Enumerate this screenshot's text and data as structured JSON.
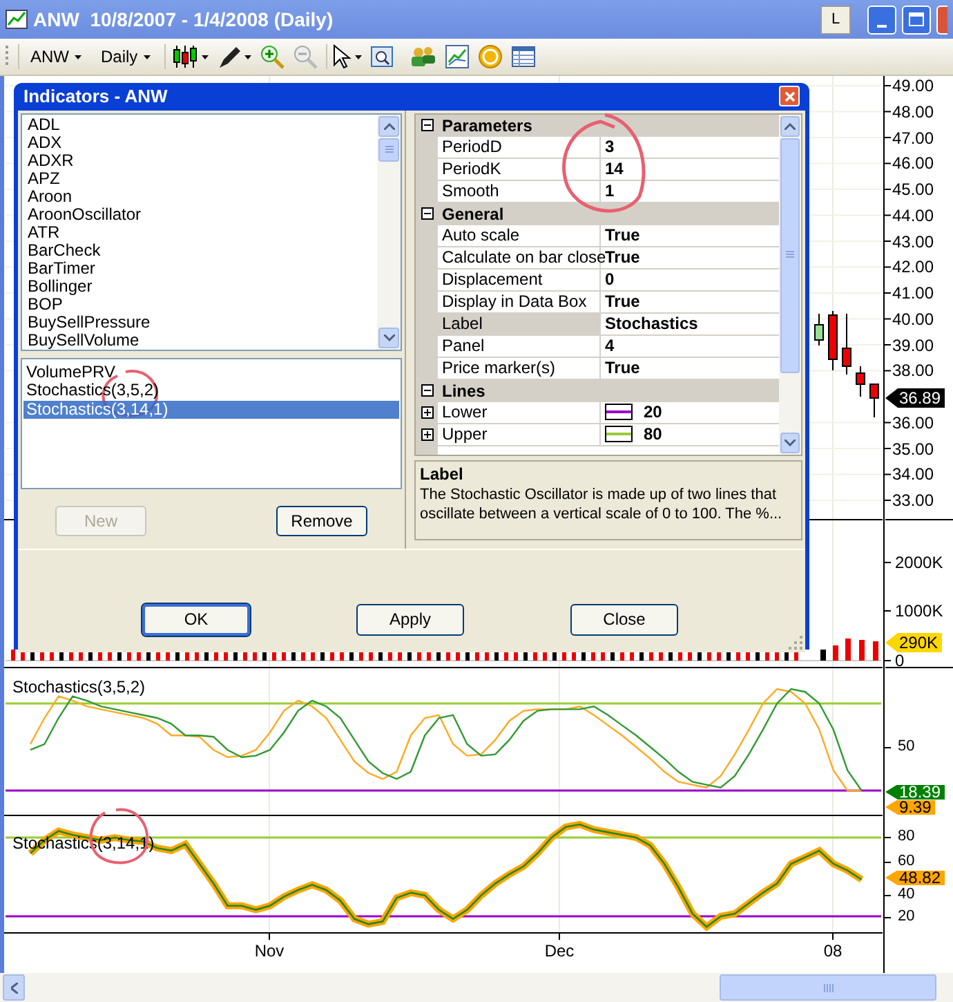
{
  "window": {
    "title": "ANW  10/8/2007 - 1/4/2008 (Daily)",
    "badge": "L"
  },
  "toolbar": {
    "symbol": "ANW",
    "interval": "Daily"
  },
  "price_axis": [
    "49.00",
    "48.00",
    "47.00",
    "46.00",
    "45.00",
    "44.00",
    "43.00",
    "42.00",
    "41.00",
    "40.00",
    "39.00",
    "38.00",
    "36.00",
    "35.00",
    "34.00",
    "33.00"
  ],
  "last_price": {
    "text": "36.89",
    "color": "#000000"
  },
  "volume_axis": [
    "2000K",
    "1000K",
    "0"
  ],
  "last_volume": {
    "text": "290K",
    "color": "#ffd700"
  },
  "panels": [
    {
      "title": "Stochastics(3,5,2)",
      "ticks": [
        "50"
      ],
      "markers": [
        {
          "text": "18.39",
          "color": "#008000"
        },
        {
          "text": "9.39",
          "color": "#ffa500"
        }
      ]
    },
    {
      "title": "Stochastics(3,14,1)",
      "ticks": [
        "80",
        "60",
        "40",
        "20"
      ],
      "markers": [
        {
          "text": "48.82",
          "color": "#ffa500"
        }
      ]
    }
  ],
  "time_axis": [
    "Nov",
    "Dec",
    "08"
  ],
  "dialog": {
    "title": "Indicators - ANW",
    "available": [
      {
        "label": "ADL",
        "selected": false
      },
      {
        "label": "ADX",
        "selected": false
      },
      {
        "label": "ADXR",
        "selected": false
      },
      {
        "label": "APZ",
        "selected": false
      },
      {
        "label": "Aroon",
        "selected": false
      },
      {
        "label": "AroonOscillator",
        "selected": false
      },
      {
        "label": "ATR",
        "selected": false
      },
      {
        "label": "BarCheck",
        "selected": false
      },
      {
        "label": "BarTimer",
        "selected": false
      },
      {
        "label": "Bollinger",
        "selected": false
      },
      {
        "label": "BOP",
        "selected": false
      },
      {
        "label": "BuySellPressure",
        "selected": false
      },
      {
        "label": "BuySellVolume",
        "selected": false
      }
    ],
    "applied": [
      {
        "label": "VolumePRV",
        "selected": false
      },
      {
        "label": "Stochastics(3,5,2)",
        "selected": false
      },
      {
        "label": "Stochastics(3,14,1)",
        "selected": true
      }
    ],
    "list_buttons": [
      {
        "label": "New",
        "disabled": true
      },
      {
        "label": "Remove",
        "disabled": false
      }
    ],
    "properties": [
      {
        "name": "Parameters",
        "expanded": true,
        "rows": [
          {
            "name": "PeriodD",
            "value": "3",
            "selected": false
          },
          {
            "name": "PeriodK",
            "value": "14",
            "selected": false
          },
          {
            "name": "Smooth",
            "value": "1",
            "selected": false
          }
        ]
      },
      {
        "name": "General",
        "expanded": true,
        "rows": [
          {
            "name": "Auto scale",
            "value": "True",
            "selected": false
          },
          {
            "name": "Calculate on bar close",
            "value": "True",
            "selected": false
          },
          {
            "name": "Displacement",
            "value": "0",
            "selected": false
          },
          {
            "name": "Display in Data Box",
            "value": "True",
            "selected": false
          },
          {
            "name": "Label",
            "value": "Stochastics",
            "selected": true
          },
          {
            "name": "Panel",
            "value": "4",
            "selected": false
          },
          {
            "name": "Price marker(s)",
            "value": "True",
            "selected": false
          }
        ]
      },
      {
        "name": "Lines",
        "expanded": true,
        "rows": [
          {
            "name": "Lower",
            "value": "20",
            "selected": false,
            "expanded": false,
            "color": "#9900cc"
          },
          {
            "name": "Upper",
            "value": "80",
            "selected": false,
            "expanded": false,
            "color": "#99cc33"
          }
        ]
      }
    ],
    "description": {
      "title": "Label",
      "text": "The Stochastic Oscillator is made up of two lines that oscillate between a vertical scale of 0 to 100. The %..."
    },
    "buttons": [
      {
        "label": "OK",
        "default": true
      },
      {
        "label": "Apply",
        "default": false
      },
      {
        "label": "Close",
        "default": false
      }
    ]
  }
}
